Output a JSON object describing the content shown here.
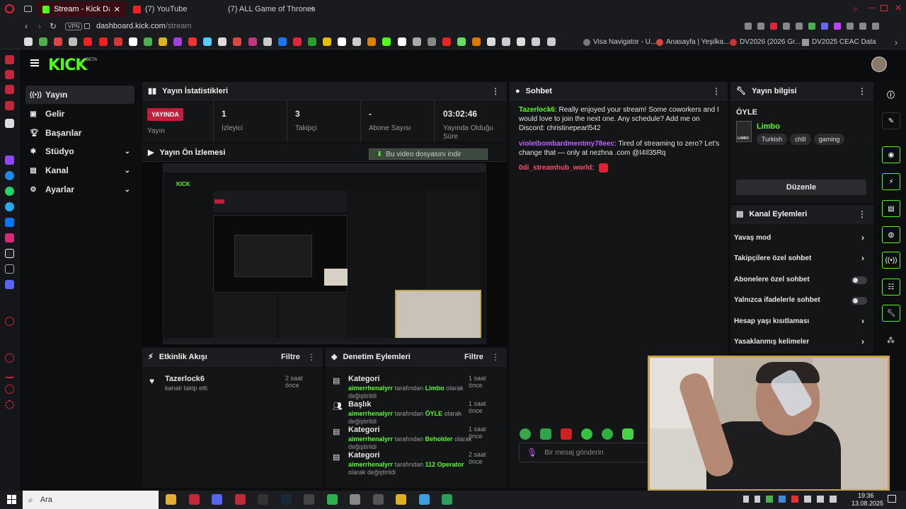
{
  "browser": {
    "tabs": [
      {
        "label": "Stream - Kick Dashb"
      },
      {
        "label": "(7) YouTube"
      },
      {
        "label": "(7) ALL Game of Thrones"
      }
    ],
    "vpn": "VPN",
    "url_domain": "dashboard.kick.com",
    "url_path": "/stream",
    "bookmarks": [
      {
        "label": "Visa Navigator - U..."
      },
      {
        "label": "Anasayfa | Yeşilka..."
      },
      {
        "label": "DV2026 (2026 Gr..."
      },
      {
        "label": "DV2025 CEAC Data"
      }
    ]
  },
  "kick": {
    "logo": "KICK",
    "logo_sup": "BETA",
    "nav": [
      {
        "label": "Yayın"
      },
      {
        "label": "Gelir"
      },
      {
        "label": "Başarılar"
      },
      {
        "label": "Stüdyo"
      },
      {
        "label": "Kanal"
      },
      {
        "label": "Ayarlar"
      }
    ]
  },
  "stats": {
    "title": "Yayın İstatistikleri",
    "live_badge": "YAYINDA",
    "live_label": "Yayın",
    "viewers_value": "1",
    "viewers_label": "İzleyici",
    "followers_value": "3",
    "followers_label": "Takipçi",
    "subs_value": "-",
    "subs_label": "Abone Sayısı",
    "time_value": "03:02:46",
    "time_label": "Yayında Olduğu Süre"
  },
  "preview": {
    "title": "Yayın Ön İzlemesi",
    "download_label": "Bu video dosyasını indir"
  },
  "activity": {
    "title": "Etkinlik Akışı",
    "filter": "Filtre",
    "items": [
      {
        "user": "Tazerlock6",
        "text": "kanalı takip etti",
        "time": "2 saat önce"
      }
    ]
  },
  "moderation": {
    "title": "Denetim Eylemleri",
    "filter": "Filtre",
    "items": [
      {
        "type": "Kategori",
        "time": "1 saat önce",
        "user": "aimerrhenalyrr",
        "mid": "tarafından",
        "value": "Limbo",
        "end": "olarak değiştirildi"
      },
      {
        "type": "Başlık",
        "time": "1 saat önce",
        "user": "aimerrhenalyrr",
        "mid": "tarafından",
        "value": "ÖYLE",
        "end": "olarak değiştirildi"
      },
      {
        "type": "Kategori",
        "time": "1 saat önce",
        "user": "aimerrhenalyrr",
        "mid": "tarafından",
        "value": "Beholder",
        "end": "olarak değiştirildi"
      },
      {
        "type": "Kategori",
        "time": "2 saat önce",
        "user": "aimerrhenalyrr",
        "mid": "tarafından",
        "value": "112 Operator",
        "end": "olarak değiştirildi"
      }
    ]
  },
  "chat": {
    "title": "Sohbet",
    "messages": [
      {
        "user": "Tazerlock6",
        "user_color": "#53fc18",
        "text": ": Really enjoyed your stream! Some coworkers and I would love to join the next one. Any schedule? Add me on Discord: christinepearl542"
      },
      {
        "user": "violetbombardmentmy78eec",
        "user_color": "#c061ff",
        "text": ": Tired of streaming to zero? Let's change that — only at nezhna .com @I4Il35Rq"
      },
      {
        "user": "0di_streamhub_world",
        "user_color": "#ff4d6d",
        "text": ":"
      }
    ],
    "input_placeholder": "Bir mesaj gönderin"
  },
  "info": {
    "title": "Yayın bilgisi",
    "stream_title": "ÖYLE",
    "category": "Limbo",
    "thumb_label": "LIMBO",
    "tags": [
      "Turkish",
      "chill",
      "gaming"
    ],
    "edit_button": "Düzenle"
  },
  "channel_actions": {
    "title": "Kanal Eylemleri",
    "items": [
      {
        "label": "Yavaş mod",
        "control": "arrow"
      },
      {
        "label": "Takipçilere özel sohbet",
        "control": "arrow"
      },
      {
        "label": "Abonelere özel sohbet",
        "control": "toggle"
      },
      {
        "label": "Yalnızca ifadelerle sohbet",
        "control": "toggle"
      },
      {
        "label": "Hesap yaşı kısıtlaması",
        "control": "arrow"
      },
      {
        "label": "Yasaklanmış kelimeler",
        "control": "arrow"
      }
    ]
  },
  "taskbar": {
    "search_placeholder": "Ara",
    "time": "19:36",
    "date": "13.08.2025"
  },
  "colors": {
    "accent": "#53fc18",
    "live": "#c21e3a",
    "bg": "#0d0e10",
    "panel": "#141517"
  }
}
